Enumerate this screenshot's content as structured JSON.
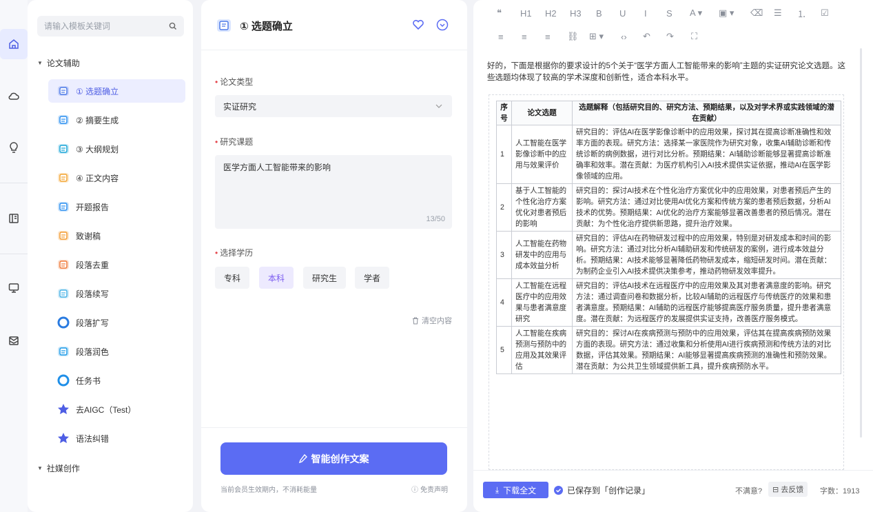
{
  "rail": {
    "icons": [
      "home-icon",
      "cloud-icon",
      "bulb-icon",
      "book-icon",
      "monitor-icon",
      "mail-icon"
    ]
  },
  "templates": {
    "search_placeholder": "请输入模板关键词",
    "group1": "论文辅助",
    "group2": "社媒创作",
    "items": [
      {
        "label": "① 选题确立",
        "color": "#4e7be8"
      },
      {
        "label": "② 摘要生成",
        "color": "#2b8ff0"
      },
      {
        "label": "③ 大纲规划",
        "color": "#1aa6d8"
      },
      {
        "label": "④ 正文内容",
        "color": "#f3a532"
      },
      {
        "label": "开题报告",
        "color": "#2b8ff0"
      },
      {
        "label": "致谢稿",
        "color": "#f39c32"
      },
      {
        "label": "段落去重",
        "color": "#f07a3a"
      },
      {
        "label": "段落续写",
        "color": "#4bb3e6"
      },
      {
        "label": "段落扩写",
        "color": "#2a7be0"
      },
      {
        "label": "段落润色",
        "color": "#1e9be8"
      },
      {
        "label": "任务书",
        "color": "#1f8fe8"
      },
      {
        "label": "去AIGC（Test）",
        "color": "#4e5ee4"
      },
      {
        "label": "语法纠错",
        "color": "#4e5ee4"
      }
    ]
  },
  "form": {
    "title": "① 选题确立",
    "type_label": "论文类型",
    "type_value": "实证研究",
    "topic_label": "研究课题",
    "topic_value": "医学方面人工智能带来的影响",
    "counter": "13/50",
    "edu_label": "选择学历",
    "edu_options": [
      "专科",
      "本科",
      "研究生",
      "学者"
    ],
    "clear": "清空内容",
    "generate": "智能创作文案",
    "note": "当前会员生效期内，不消耗能量",
    "disclaimer": "免责声明"
  },
  "editor": {
    "toolbar_row1": [
      "❝",
      "H1",
      "H2",
      "H3",
      "B",
      "U",
      "I",
      "S",
      "A ▾",
      "▣ ▾",
      "⌫",
      "☰",
      "⒈",
      "☑"
    ],
    "toolbar_row2": [
      "≡",
      "≡",
      "≡",
      "⛓",
      "⊞ ▾",
      "‹›",
      "↶",
      "↷",
      "⛶"
    ],
    "intro": "好的，下面是根据你的要求设计的5个关于“医学方面人工智能带来的影响”主题的实证研究论文选题。这些选题均体现了较高的学术深度和创新性，适合本科水平。",
    "table": {
      "headers": [
        "序号",
        "论文选题",
        "选题解释（包括研究目的、研究方法、预期结果，以及对学术界或实践领域的潜在贡献）"
      ],
      "rows": [
        [
          "1",
          "人工智能在医学影像诊断中的应用与效果评价",
          "研究目的：评估AI在医学影像诊断中的应用效果，探讨其在提高诊断准确性和效率方面的表现。研究方法：选择某一家医院作为研究对象，收集AI辅助诊断和传统诊断的病例数据，进行对比分析。预期结果：AI辅助诊断能够显著提高诊断准确率和效率。潜在贡献：为医疗机构引入AI技术提供实证依据，推动AI在医学影像领域的应用。"
        ],
        [
          "2",
          "基于人工智能的个性化治疗方案优化对患者预后的影响",
          "研究目的：探讨AI技术在个性化治疗方案优化中的应用效果，对患者预后产生的影响。研究方法：通过对比使用AI优化方案和传统方案的患者预后数据，分析AI技术的优势。预期结果：AI优化的治疗方案能够显著改善患者的预后情况。潜在贡献：为个性化治疗提供新思路，提升治疗效果。"
        ],
        [
          "3",
          "人工智能在药物研发中的应用与成本效益分析",
          "研究目的：评估AI在药物研发过程中的应用效果，特别是对研发成本和时间的影响。研究方法：通过对比分析AI辅助研发和传统研发的案例，进行成本效益分析。预期结果：AI技术能够显著降低药物研发成本，缩短研发时间。潜在贡献：为制药企业引入AI技术提供决策参考，推动药物研发效率提升。"
        ],
        [
          "4",
          "人工智能在远程医疗中的应用效果与患者满意度研究",
          "研究目的：评估AI技术在远程医疗中的应用效果及其对患者满意度的影响。研究方法：通过调查问卷和数据分析，比较AI辅助的远程医疗与传统医疗的效果和患者满意度。预期结果：AI辅助的远程医疗能够提高医疗服务质量，提升患者满意度。潜在贡献：为远程医疗的发展提供实证支持，改善医疗服务模式。"
        ],
        [
          "5",
          "人工智能在疾病预测与预防中的应用及其效果评估",
          "研究目的：探讨AI在疾病预测与预防中的应用效果，评估其在提高疾病预防效果方面的表现。研究方法：通过收集和分析使用AI进行疾病预测和传统方法的对比数据，评估其效果。预期结果：AI能够显著提高疾病预测的准确性和预防效果。潜在贡献：为公共卫生领域提供新工具，提升疾病预防水平。"
        ]
      ]
    },
    "download": "下载全文",
    "saved": "已保存到「创作记录」",
    "unsatisfied": "不满意?",
    "feedback": "去反馈",
    "word_count": "字数：1913"
  },
  "colors": {
    "accent": "#5b6cf3",
    "active_bg": "#eceeff",
    "chip_active": "#7b5cf0"
  }
}
